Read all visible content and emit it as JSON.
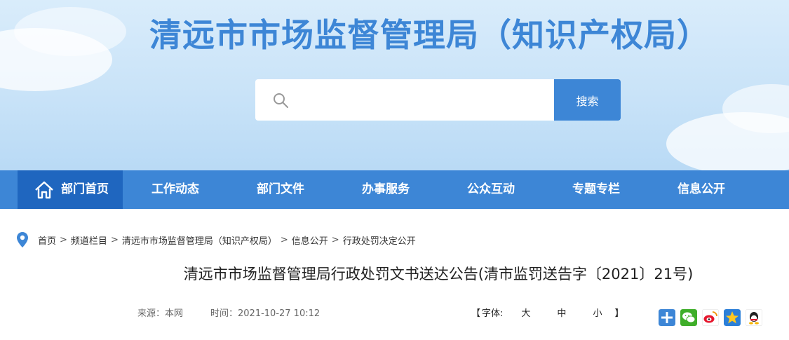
{
  "header": {
    "site_title": "清远市市场监督管理局（知识产权局）",
    "search_placeholder": "",
    "search_button": "搜索"
  },
  "nav": {
    "items": [
      {
        "label": "部门首页",
        "icon": "home-icon",
        "active": true
      },
      {
        "label": "工作动态"
      },
      {
        "label": "部门文件"
      },
      {
        "label": "办事服务"
      },
      {
        "label": "公众互动"
      },
      {
        "label": "专题专栏"
      },
      {
        "label": "信息公开"
      }
    ]
  },
  "breadcrumb": {
    "icon": "location-pin-icon",
    "items": [
      "首页",
      "频道栏目",
      "清远市市场监督管理局（知识产权局）",
      "信息公开",
      "行政处罚决定公开"
    ],
    "separator": ">"
  },
  "article": {
    "title": "清远市市场监督管理局行政处罚文书送达公告(清市监罚送告字〔2021〕21号)",
    "source": "来源：本网",
    "time": "时间：2021-10-27 10:12",
    "font_size": {
      "open": "【",
      "label": "字体:",
      "large": "大",
      "medium": "中",
      "small": "小",
      "close": "】"
    },
    "share_icons": [
      "share-plus-icon",
      "wechat-icon",
      "weibo-icon",
      "qzone-icon",
      "qq-icon"
    ]
  },
  "colors": {
    "brand_blue": "#3d86d6",
    "nav_active": "#1f66bf",
    "banner_sky": "#c9e3f8"
  }
}
